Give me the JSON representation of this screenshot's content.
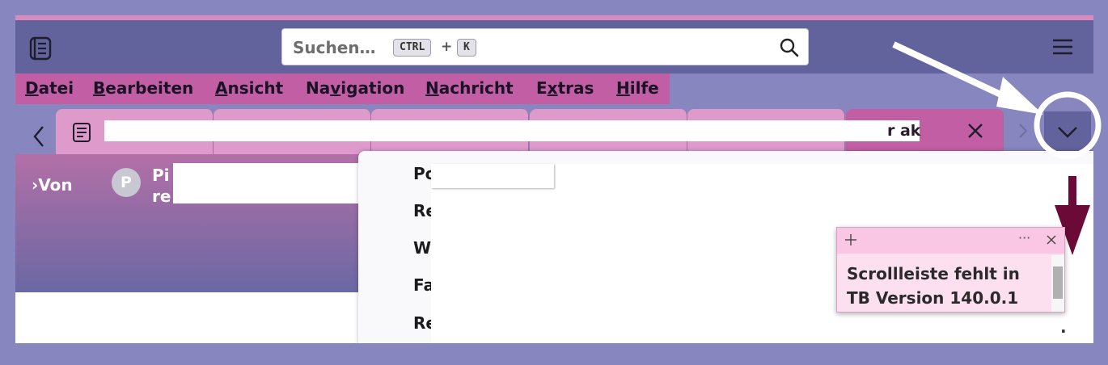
{
  "search": {
    "placeholder": "Suchen…",
    "key1": "CTRL",
    "plus": "+",
    "key2": "K"
  },
  "menu": [
    {
      "key": "D",
      "rest": "atei"
    },
    {
      "key": "B",
      "rest": "earbeiten"
    },
    {
      "key": "A",
      "rest": "nsicht"
    },
    {
      "pre": "Na",
      "key": "v",
      "rest": "igation"
    },
    {
      "key": "N",
      "rest": "achricht"
    },
    {
      "pre": "E",
      "key": "x",
      "rest": "tras"
    },
    {
      "key": "H",
      "rest": "ilfe"
    }
  ],
  "tabs": {
    "active_title_fragment": "r ak"
  },
  "header": {
    "von_label": "Von",
    "avatar_letter": "P",
    "sender_line1": "Pi",
    "sender_line2": "re",
    "dot": "."
  },
  "dropdown": {
    "items": [
      "Po",
      "Re",
      "W",
      "Fa",
      "Re"
    ],
    "trailing": "."
  },
  "note": {
    "text": "Scrollleiste fehlt in TB Version 140.0.1",
    "more": "···"
  },
  "colors": {
    "toolbar": "#62629c",
    "menubar": "#c25ea3",
    "tab": "#de9acb",
    "arrow_dark": "#6b0a36"
  }
}
